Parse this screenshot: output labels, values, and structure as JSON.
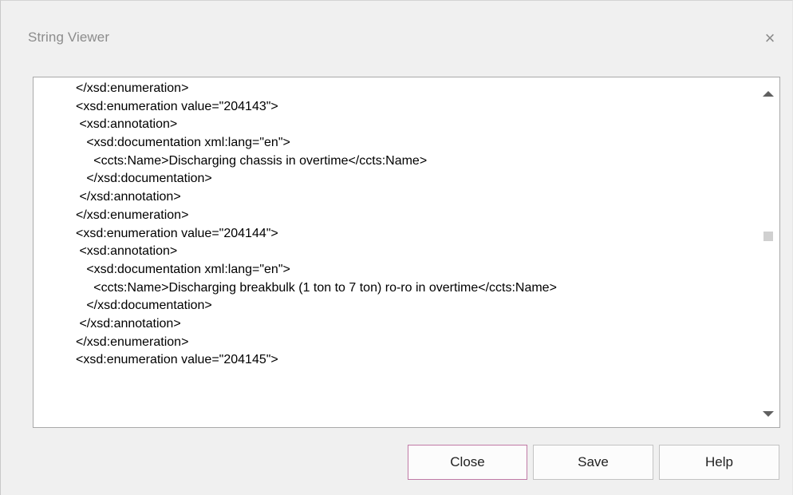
{
  "dialog": {
    "title": "String Viewer",
    "close_glyph": "×"
  },
  "viewer": {
    "lines": [
      "</xsd:enumeration>",
      "<xsd:enumeration value=\"204143\">",
      " <xsd:annotation>",
      "   <xsd:documentation xml:lang=\"en\">",
      "     <ccts:Name>Discharging chassis in overtime</ccts:Name>",
      "   </xsd:documentation>",
      " </xsd:annotation>",
      "</xsd:enumeration>",
      "<xsd:enumeration value=\"204144\">",
      " <xsd:annotation>",
      "   <xsd:documentation xml:lang=\"en\">",
      "     <ccts:Name>Discharging breakbulk (1 ton to 7 ton) ro-ro in overtime</ccts:Name>",
      "   </xsd:documentation>",
      " </xsd:annotation>",
      "</xsd:enumeration>",
      "<xsd:enumeration value=\"204145\">"
    ],
    "scrollbar": {
      "up_icon": "scroll-up-arrow",
      "down_icon": "scroll-down-arrow"
    }
  },
  "buttons": {
    "close_label": "Close",
    "save_label": "Save",
    "help_label": "Help"
  },
  "colors": {
    "dialog_bg": "#f0f0f0",
    "default_button_border": "#c07aa6"
  }
}
